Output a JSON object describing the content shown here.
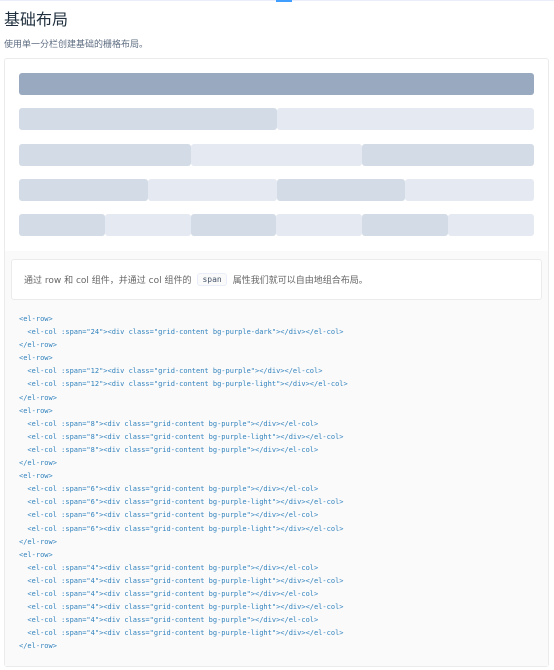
{
  "page": {
    "title": "基础布局",
    "description": "使用单一分栏创建基础的栅格布局。"
  },
  "colors": {
    "purple_dark": "#99a9bf",
    "purple": "#d3dce6",
    "purple_light": "#e5e9f2"
  },
  "grid_rows": [
    {
      "cols": [
        {
          "span": 24,
          "color": "purple_dark"
        }
      ]
    },
    {
      "cols": [
        {
          "span": 12,
          "color": "purple"
        },
        {
          "span": 12,
          "color": "purple_light"
        }
      ]
    },
    {
      "cols": [
        {
          "span": 8,
          "color": "purple"
        },
        {
          "span": 8,
          "color": "purple_light"
        },
        {
          "span": 8,
          "color": "purple"
        }
      ]
    },
    {
      "cols": [
        {
          "span": 6,
          "color": "purple"
        },
        {
          "span": 6,
          "color": "purple_light"
        },
        {
          "span": 6,
          "color": "purple"
        },
        {
          "span": 6,
          "color": "purple_light"
        }
      ]
    },
    {
      "cols": [
        {
          "span": 4,
          "color": "purple"
        },
        {
          "span": 4,
          "color": "purple_light"
        },
        {
          "span": 4,
          "color": "purple"
        },
        {
          "span": 4,
          "color": "purple_light"
        },
        {
          "span": 4,
          "color": "purple"
        },
        {
          "span": 4,
          "color": "purple_light"
        }
      ]
    }
  ],
  "meta": {
    "description_before": "通过 row 和 col 组件，并通过 col 组件的",
    "description_code": "span",
    "description_after": "属性我们就可以自由地组合布局。",
    "code_lines": [
      "<el-row>",
      "  <el-col :span=\"24\"><div class=\"grid-content bg-purple-dark\"></div></el-col>",
      "</el-row>",
      "<el-row>",
      "  <el-col :span=\"12\"><div class=\"grid-content bg-purple\"></div></el-col>",
      "  <el-col :span=\"12\"><div class=\"grid-content bg-purple-light\"></div></el-col>",
      "</el-row>",
      "<el-row>",
      "  <el-col :span=\"8\"><div class=\"grid-content bg-purple\"></div></el-col>",
      "  <el-col :span=\"8\"><div class=\"grid-content bg-purple-light\"></div></el-col>",
      "  <el-col :span=\"8\"><div class=\"grid-content bg-purple\"></div></el-col>",
      "</el-row>",
      "<el-row>",
      "  <el-col :span=\"6\"><div class=\"grid-content bg-purple\"></div></el-col>",
      "  <el-col :span=\"6\"><div class=\"grid-content bg-purple-light\"></div></el-col>",
      "  <el-col :span=\"6\"><div class=\"grid-content bg-purple\"></div></el-col>",
      "  <el-col :span=\"6\"><div class=\"grid-content bg-purple-light\"></div></el-col>",
      "</el-row>",
      "<el-row>",
      "  <el-col :span=\"4\"><div class=\"grid-content bg-purple\"></div></el-col>",
      "  <el-col :span=\"4\"><div class=\"grid-content bg-purple-light\"></div></el-col>",
      "  <el-col :span=\"4\"><div class=\"grid-content bg-purple\"></div></el-col>",
      "  <el-col :span=\"4\"><div class=\"grid-content bg-purple-light\"></div></el-col>",
      "  <el-col :span=\"4\"><div class=\"grid-content bg-purple\"></div></el-col>",
      "  <el-col :span=\"4\"><div class=\"grid-content bg-purple-light\"></div></el-col>",
      "</el-row>"
    ]
  }
}
